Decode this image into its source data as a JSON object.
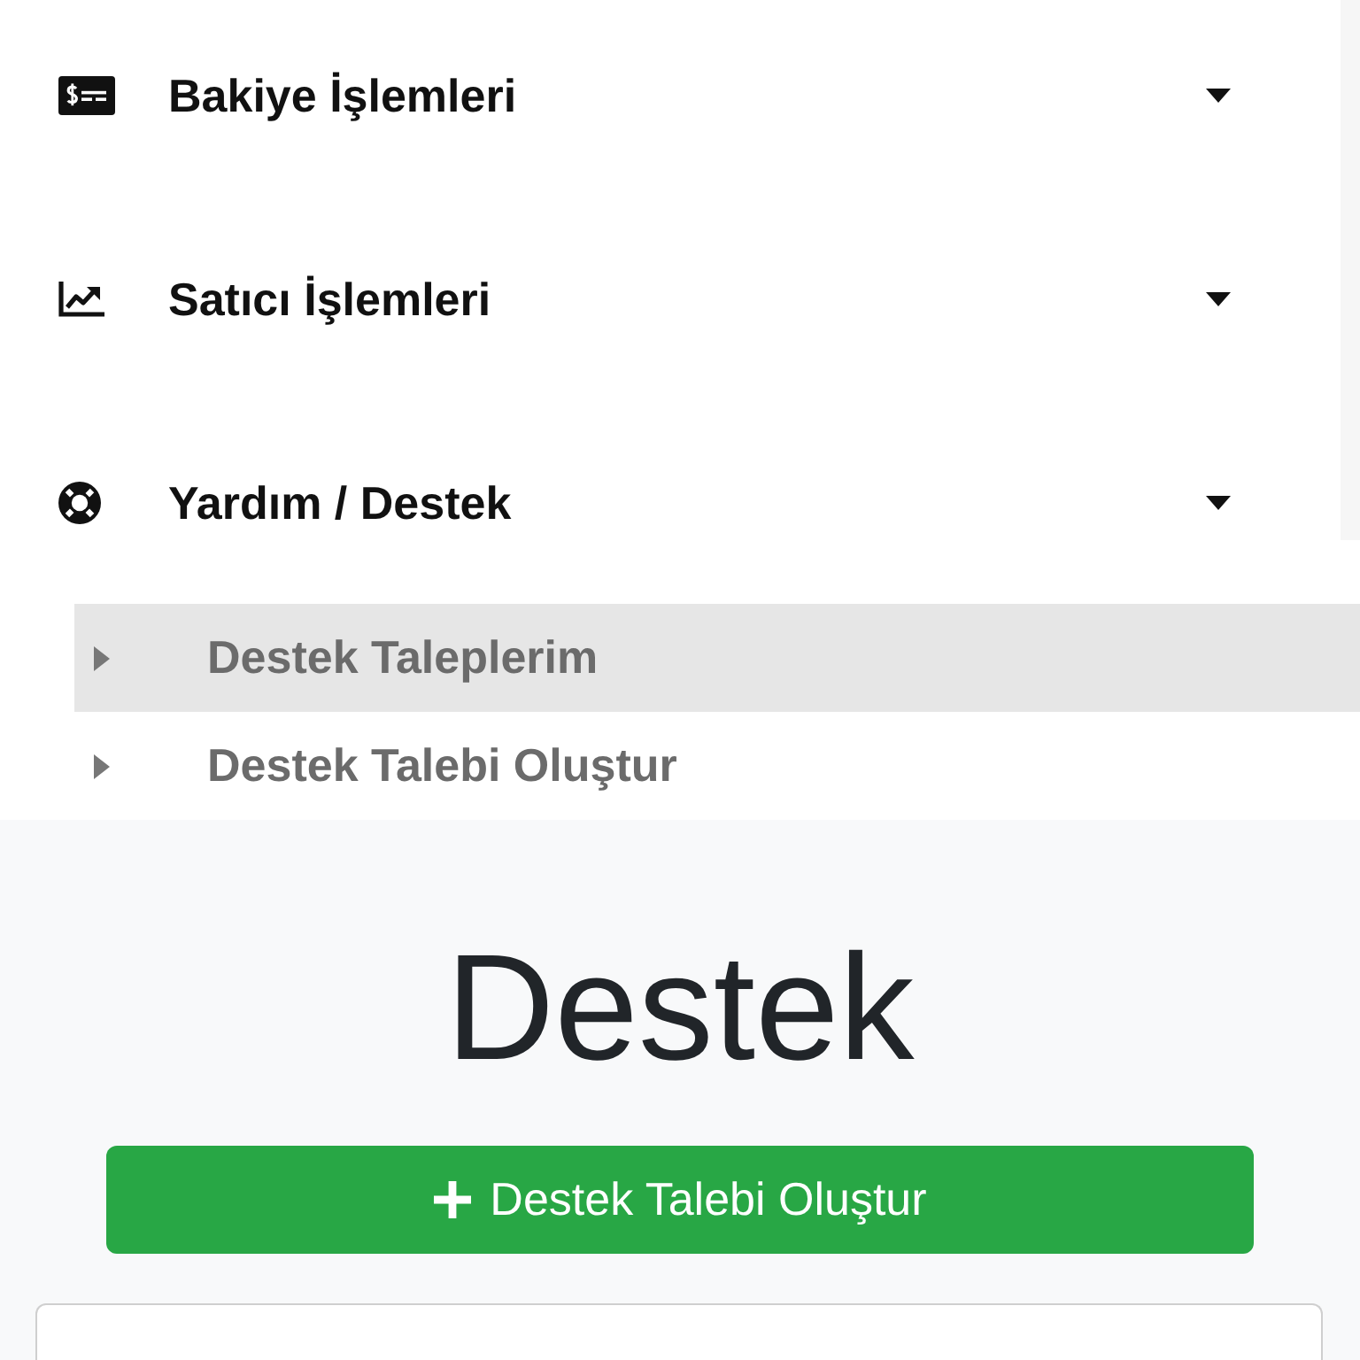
{
  "menu": {
    "items": [
      {
        "label": "Bakiye İşlemleri"
      },
      {
        "label": "Satıcı İşlemleri"
      },
      {
        "label": "Yardım / Destek",
        "children": [
          {
            "label": "Destek Taleplerim",
            "selected": true
          },
          {
            "label": "Destek Talebi Oluştur",
            "selected": false
          }
        ]
      }
    ]
  },
  "page": {
    "title": "Destek",
    "create_button": {
      "label": "Destek Talebi Oluştur"
    }
  }
}
